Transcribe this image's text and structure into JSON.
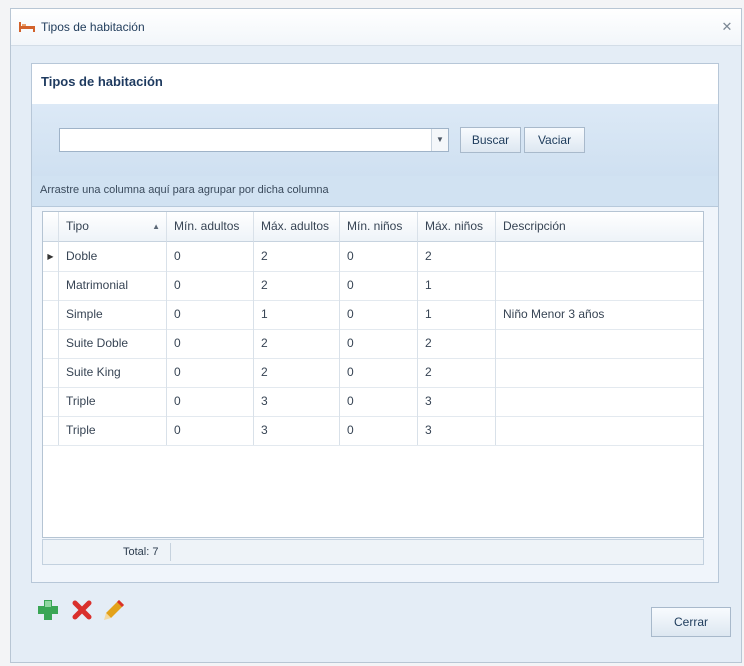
{
  "window": {
    "title": "Tipos de habitación"
  },
  "group": {
    "title": "Tipos de habitación"
  },
  "search": {
    "value": "",
    "buscar_label": "Buscar",
    "vaciar_label": "Vaciar"
  },
  "groupby_hint": "Arrastre una columna aquí para agrupar por dicha columna",
  "table": {
    "columns": [
      "Tipo",
      "Mín. adultos",
      "Máx. adultos",
      "Mín. niños",
      "Máx. niños",
      "Descripción"
    ],
    "rows": [
      [
        "Doble",
        "0",
        "2",
        "0",
        "2",
        ""
      ],
      [
        "Matrimonial",
        "0",
        "2",
        "0",
        "1",
        ""
      ],
      [
        "Simple",
        "0",
        "1",
        "0",
        "1",
        "Niño Menor 3 años"
      ],
      [
        "Suite Doble",
        "0",
        "2",
        "0",
        "2",
        ""
      ],
      [
        "Suite King",
        "0",
        "2",
        "0",
        "2",
        ""
      ],
      [
        "Triple",
        "0",
        "3",
        "0",
        "3",
        ""
      ],
      [
        "Triple",
        "0",
        "3",
        "0",
        "3",
        ""
      ]
    ],
    "sort_column": "Tipo",
    "sort_direction": "ascending",
    "current_row": 0
  },
  "footer": {
    "total_label": "Total: 7"
  },
  "toolbar": {
    "add_icon": "add-icon",
    "delete_icon": "delete-icon",
    "edit_icon": "edit-icon"
  },
  "close_button": {
    "label": "Cerrar"
  },
  "colors": {
    "accent": "#1e3a5f",
    "add": "#3aa655",
    "delete": "#d9302c",
    "edit": "#e3a21a"
  }
}
